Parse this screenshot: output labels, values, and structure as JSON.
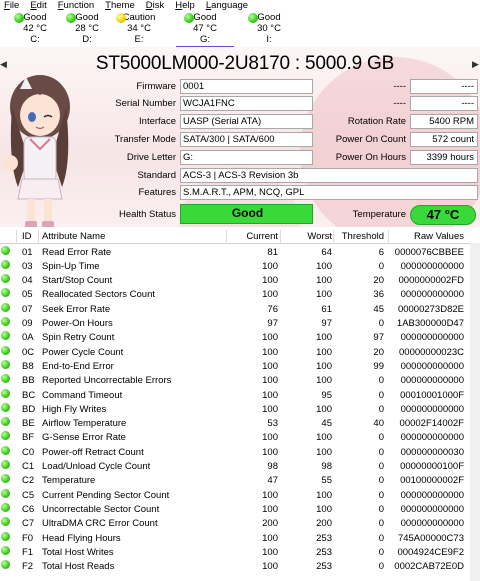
{
  "menu": [
    "File",
    "Edit",
    "Function",
    "Theme",
    "Disk",
    "Help",
    "Language"
  ],
  "disks": [
    {
      "status": "Good",
      "temp": "42 °C",
      "letter": "C:",
      "level": "good"
    },
    {
      "status": "Good",
      "temp": "28 °C",
      "letter": "D:",
      "level": "good"
    },
    {
      "status": "Caution",
      "temp": "34 °C",
      "letter": "E:",
      "level": "caution"
    },
    {
      "status": "Good",
      "temp": "47 °C",
      "letter": "G:",
      "level": "good"
    },
    {
      "status": "Good",
      "temp": "30 °C",
      "letter": "I:",
      "level": "good"
    }
  ],
  "nav": {
    "prev": "◀",
    "next": "▶"
  },
  "title": "ST5000LM000-2U8170 : 5000.9 GB",
  "info": {
    "firmware_label": "Firmware",
    "firmware": "0001",
    "serial_label": "Serial Number",
    "serial": "WCJA1FNC",
    "interface_label": "Interface",
    "interface": "UASP (Serial ATA)",
    "transfer_label": "Transfer Mode",
    "transfer": "SATA/300 | SATA/600",
    "drive_letter_label": "Drive Letter",
    "drive_letter": "G:",
    "standard_label": "Standard",
    "standard": "ACS-3 | ACS-3 Revision 3b",
    "features_label": "Features",
    "features": "S.M.A.R.T., APM, NCQ, GPL",
    "health_label": "Health Status",
    "health": "Good",
    "temperature_label": "Temperature",
    "temperature": "47 °C",
    "right_top1_label": "----",
    "right_top1": "----",
    "right_top2_label": "----",
    "right_top2": "----",
    "rotation_label": "Rotation Rate",
    "rotation": "5400 RPM",
    "power_count_label": "Power On Count",
    "power_count": "572 count",
    "power_hours_label": "Power On Hours",
    "power_hours": "3399 hours"
  },
  "table": {
    "headers": {
      "id": "ID",
      "name": "Attribute Name",
      "current": "Current",
      "worst": "Worst",
      "threshold": "Threshold",
      "raw": "Raw Values"
    },
    "rows": [
      {
        "id": "01",
        "name": "Read Error Rate",
        "current": "81",
        "worst": "64",
        "threshold": "6",
        "raw": "0000076CBBEE"
      },
      {
        "id": "03",
        "name": "Spin-Up Time",
        "current": "100",
        "worst": "100",
        "threshold": "0",
        "raw": "000000000000"
      },
      {
        "id": "04",
        "name": "Start/Stop Count",
        "current": "100",
        "worst": "100",
        "threshold": "20",
        "raw": "0000000002FD"
      },
      {
        "id": "05",
        "name": "Reallocated Sectors Count",
        "current": "100",
        "worst": "100",
        "threshold": "36",
        "raw": "000000000000"
      },
      {
        "id": "07",
        "name": "Seek Error Rate",
        "current": "76",
        "worst": "61",
        "threshold": "45",
        "raw": "00000273D82E"
      },
      {
        "id": "09",
        "name": "Power-On Hours",
        "current": "97",
        "worst": "97",
        "threshold": "0",
        "raw": "1AB300000D47"
      },
      {
        "id": "0A",
        "name": "Spin Retry Count",
        "current": "100",
        "worst": "100",
        "threshold": "97",
        "raw": "000000000000"
      },
      {
        "id": "0C",
        "name": "Power Cycle Count",
        "current": "100",
        "worst": "100",
        "threshold": "20",
        "raw": "00000000023C"
      },
      {
        "id": "B8",
        "name": "End-to-End Error",
        "current": "100",
        "worst": "100",
        "threshold": "99",
        "raw": "000000000000"
      },
      {
        "id": "BB",
        "name": "Reported Uncorrectable Errors",
        "current": "100",
        "worst": "100",
        "threshold": "0",
        "raw": "000000000000"
      },
      {
        "id": "BC",
        "name": "Command Timeout",
        "current": "100",
        "worst": "95",
        "threshold": "0",
        "raw": "00010001000F"
      },
      {
        "id": "BD",
        "name": "High Fly Writes",
        "current": "100",
        "worst": "100",
        "threshold": "0",
        "raw": "000000000000"
      },
      {
        "id": "BE",
        "name": "Airflow Temperature",
        "current": "53",
        "worst": "45",
        "threshold": "40",
        "raw": "00002F14002F"
      },
      {
        "id": "BF",
        "name": "G-Sense Error Rate",
        "current": "100",
        "worst": "100",
        "threshold": "0",
        "raw": "000000000000"
      },
      {
        "id": "C0",
        "name": "Power-off Retract Count",
        "current": "100",
        "worst": "100",
        "threshold": "0",
        "raw": "000000000030"
      },
      {
        "id": "C1",
        "name": "Load/Unload Cycle Count",
        "current": "98",
        "worst": "98",
        "threshold": "0",
        "raw": "00000000100F"
      },
      {
        "id": "C2",
        "name": "Temperature",
        "current": "47",
        "worst": "55",
        "threshold": "0",
        "raw": "00100000002F"
      },
      {
        "id": "C5",
        "name": "Current Pending Sector Count",
        "current": "100",
        "worst": "100",
        "threshold": "0",
        "raw": "000000000000"
      },
      {
        "id": "C6",
        "name": "Uncorrectable Sector Count",
        "current": "100",
        "worst": "100",
        "threshold": "0",
        "raw": "000000000000"
      },
      {
        "id": "C7",
        "name": "UltraDMA CRC Error Count",
        "current": "200",
        "worst": "200",
        "threshold": "0",
        "raw": "000000000000"
      },
      {
        "id": "F0",
        "name": "Head Flying Hours",
        "current": "100",
        "worst": "253",
        "threshold": "0",
        "raw": "745A00000C73"
      },
      {
        "id": "F1",
        "name": "Total Host Writes",
        "current": "100",
        "worst": "253",
        "threshold": "0",
        "raw": "0004924CE9F2"
      },
      {
        "id": "F2",
        "name": "Total Host Reads",
        "current": "100",
        "worst": "253",
        "threshold": "0",
        "raw": "0002CAB72E0D"
      }
    ]
  },
  "colors": {
    "good": "#38d938",
    "caution": "#f0d200",
    "accent": "#6a4bc4"
  }
}
